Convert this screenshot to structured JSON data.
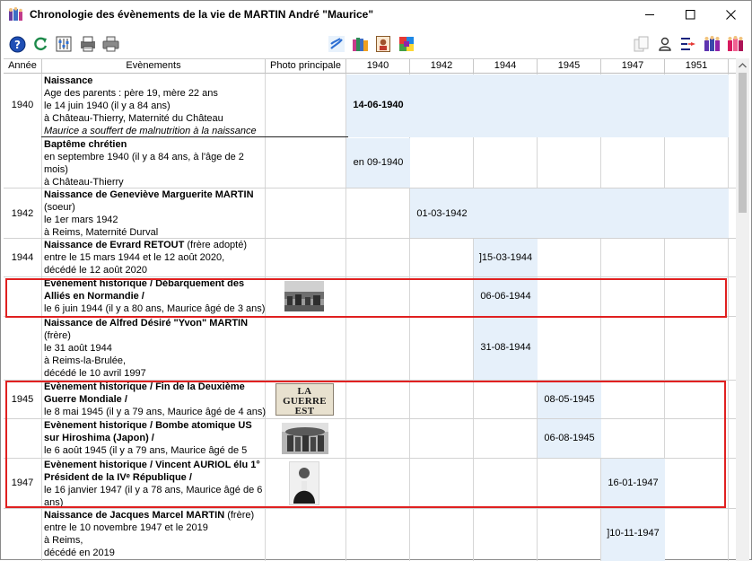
{
  "window": {
    "title": "Chronologie des évènements de la vie de MARTIN André \"Maurice\""
  },
  "toolbar": {
    "left": [
      "help-icon",
      "refresh-icon",
      "settings-icon",
      "print-preview-icon",
      "printer-icon"
    ],
    "center": [
      "filter-icon",
      "family-colors-icon",
      "portrait-icon",
      "color-palette-icon"
    ],
    "right": [
      "copy-icon",
      "person-icon",
      "list-sort-icon",
      "family-icon",
      "group-icon"
    ]
  },
  "columns": {
    "annee": "Année",
    "evenements": "Evènements",
    "photo": "Photo principale",
    "years": [
      "1940",
      "1942",
      "1944",
      "1945",
      "1947",
      "1951"
    ]
  },
  "rows": [
    {
      "annee": "1940",
      "title": "Naissance",
      "lines": [
        "Age des parents : père 19, mère 22 ans",
        "le 14 juin 1940 (il y a 84 ans)",
        "à Château-Thierry, Maternité du Château"
      ],
      "note": "Maurice a souffert de malnutrition à la naissance",
      "date": "14-06-1940"
    },
    {
      "annee": "",
      "title": "Baptême chrétien",
      "lines": [
        "en septembre 1940 (il y a 84 ans, à l'âge de 2",
        "mois)",
        "à Château-Thierry"
      ],
      "date": "en 09-1940"
    },
    {
      "annee": "1942",
      "title": "Naissance de Geneviève Marguerite MARTIN",
      "lines": [
        "(soeur)",
        "le 1er mars 1942",
        "à Reims, Maternité Durval"
      ],
      "date": "01-03-1942"
    },
    {
      "annee": "1944",
      "title": "Naissance de Evrard RETOUT",
      "title_suffix": " (frère adopté)",
      "lines": [
        "entre le 15 mars 1944 et le 12 août 2020,",
        "décédé le 12 août 2020"
      ],
      "date": "]15-03-1944"
    },
    {
      "annee": "",
      "title": "Evènement historique  /  Débarquement des Alliés en Normandie  /",
      "lines": [
        "le 6 juin 1944 (il y a 80 ans, Maurice âgé de 3 ans)"
      ],
      "date": "06-06-1944"
    },
    {
      "annee": "",
      "title": "Naissance de Alfred Désiré \"Yvon\" MARTIN",
      "lines": [
        "(frère)",
        "le 31 août 1944",
        "à Reims-la-Brulée,",
        "décédé le 10 avril 1997"
      ],
      "date": "31-08-1944"
    },
    {
      "annee": "1945",
      "title": "Evènement historique  /  Fin de la Deuxième Guerre Mondiale  /",
      "lines": [
        "le 8 mai 1945 (il y a 79 ans, Maurice âgé de 4 ans)"
      ],
      "date": "08-05-1945",
      "photo_text": "LA GUERRE EST FINIE"
    },
    {
      "annee": "",
      "title": "Evènement historique  /  Bombe atomique US sur Hiroshima (Japon)  /",
      "lines": [
        "le 6 août 1945 (il y a 79 ans, Maurice âgé de 5"
      ],
      "date": "06-08-1945"
    },
    {
      "annee": "1947",
      "title": "Evènement historique  /  Vincent AURIOL élu 1° Président de la IVᵉ République  /",
      "lines": [
        "le 16 janvier 1947 (il y a 78 ans, Maurice âgé de 6",
        "ans)"
      ],
      "date": "16-01-1947"
    },
    {
      "annee": "",
      "title": "Naissance de Jacques Marcel MARTIN",
      "title_suffix": " (frère)",
      "lines": [
        "entre le 10 novembre 1947 et le 2019",
        "à Reims,",
        "décédé en 2019"
      ],
      "date": "]10-11-1947"
    }
  ]
}
